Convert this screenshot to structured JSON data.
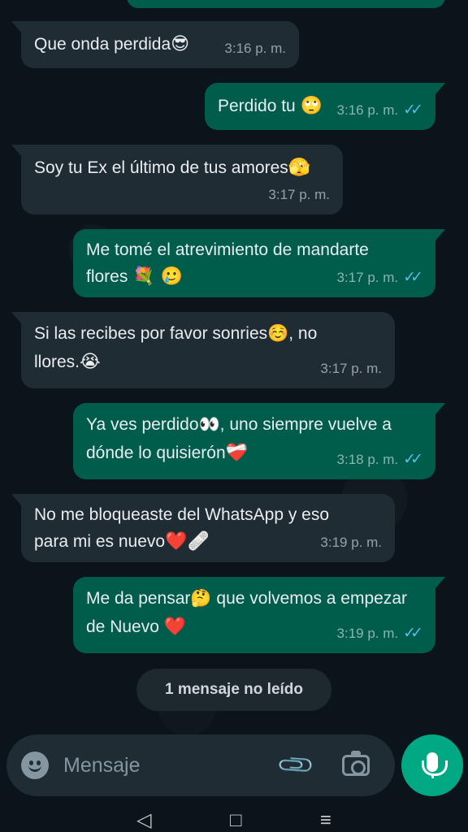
{
  "messages": [
    {
      "dir": "in",
      "text": "Que onda perdida",
      "emoji": "😎",
      "time": "3:16 p. m."
    },
    {
      "dir": "out",
      "text": "Perdido tu ",
      "emoji": "🙄",
      "time": "3:16 p. m."
    },
    {
      "dir": "in",
      "text": "Soy tu Ex el último de tus amores",
      "emoji": "🫣",
      "time": "3:17 p. m."
    },
    {
      "dir": "out",
      "text_line1": "Me tomé el atrevimiento de mandarte",
      "text_line2": "flores ",
      "emoji": "💐 🥲",
      "time": "3:17 p. m."
    },
    {
      "dir": "in",
      "text_line1": "Si las recibes por favor sonries☺️, no",
      "text_line2": "llores.",
      "emoji": "😭",
      "time": "3:17 p. m."
    },
    {
      "dir": "out",
      "text_line1": "Ya ves perdido👀, uno siempre vuelve a",
      "text_line2": "dónde lo quisierón",
      "emoji": "❤️‍🩹",
      "time": "3:18 p. m."
    },
    {
      "dir": "in",
      "text_line1": "No me bloqueaste del WhatsApp y eso",
      "text_line2": "para mi es nuevo",
      "emoji": "❤️🩹",
      "time": "3:19 p. m."
    },
    {
      "dir": "out",
      "text_line1": "Me da pensar🤔 que volvemos a empezar",
      "text_line2": "de Nuevo ",
      "emoji": "❤️",
      "time": "3:19 p. m."
    }
  ],
  "ticks": "✓✓",
  "unread_label": "1 mensaje no leído",
  "composer": {
    "placeholder": "Mensaje"
  },
  "icons": {
    "attach": "paperclip-icon",
    "camera": "camera-icon",
    "mic": "mic-icon",
    "emoji": "emoji-icon"
  },
  "nav": {
    "back": "◁",
    "home": "□",
    "recents": "≡"
  },
  "colors": {
    "incoming": "#202c33",
    "outgoing": "#005c4b",
    "accent": "#00a884",
    "read_ticks": "#53bdeb"
  }
}
